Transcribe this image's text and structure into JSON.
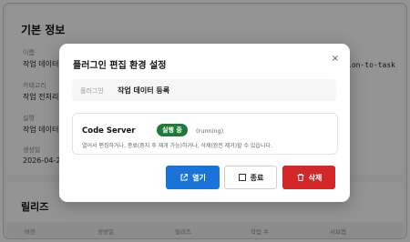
{
  "page": {
    "section_title": "기본 정보",
    "fields": [
      {
        "label": "이름",
        "value": "작업 데이터 ("
      },
      {
        "label": "카테고리",
        "value": "작업 전처리"
      },
      {
        "label": "설명",
        "value": "작업 데이터 ("
      },
      {
        "label": "생성일",
        "value": "2026-04-2"
      }
    ],
    "right_value": "ion-to-task",
    "release_title": "릴리즈",
    "table_headers": [
      "버전",
      "생성일",
      "릴리즈",
      "작업 수",
      "서브앱"
    ]
  },
  "modal": {
    "title": "플러그인 편집 환경 설정",
    "close_label": "×",
    "plugin_label": "플러그인",
    "plugin_value": "작업 데이터 등록",
    "server": {
      "name": "Code Server",
      "status_badge": "실행 중",
      "status_text": "(running)",
      "description": "열어서 편집하거나, 종료(중지 후 재개 가능)하거나, 삭제(완전 제거)할 수 있습니다."
    },
    "buttons": {
      "open": "열기",
      "stop": "종료",
      "delete": "삭제"
    },
    "colors": {
      "open": "#1a73d9",
      "delete": "#d32626",
      "badge": "#1f7a3a"
    }
  }
}
